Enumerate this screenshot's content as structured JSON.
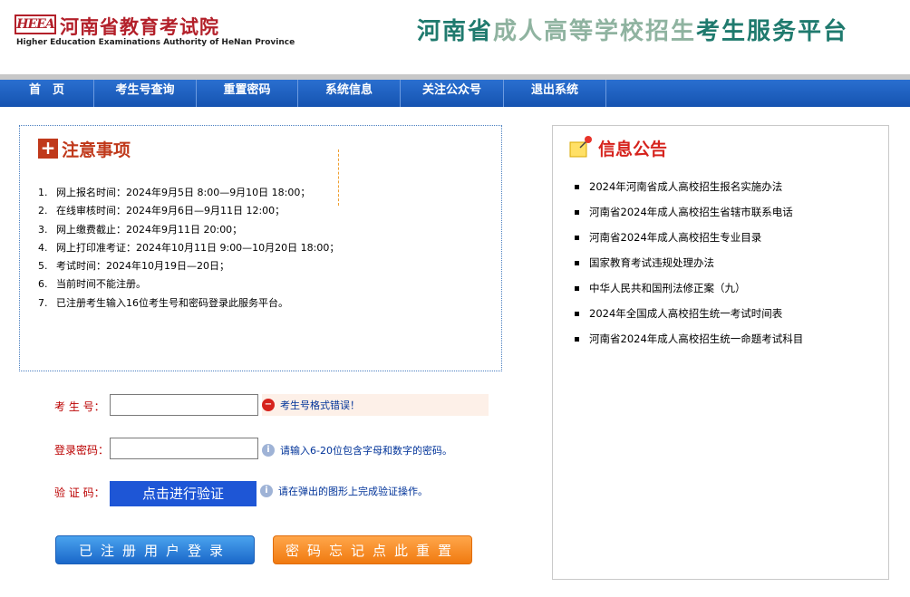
{
  "header": {
    "logo_badge": "HEEA",
    "logo_cn": "河南省教育考试院",
    "logo_en": "Higher Education Examinations Authority of HeNan Province",
    "title_part1": "河南省",
    "title_part2": "成人高等学校招生",
    "title_part3": "考生服务平台"
  },
  "nav": {
    "items": [
      {
        "label": "首　页"
      },
      {
        "label": "考生号查询"
      },
      {
        "label": "重置密码"
      },
      {
        "label": "系统信息"
      },
      {
        "label": "关注公众号"
      },
      {
        "label": "退出系统"
      }
    ]
  },
  "notice": {
    "title": "注意事项",
    "icon": "plus-icon",
    "items": [
      {
        "num": "1.",
        "text": "网上报名时间：2024年9月5日 8:00—9月10日 18:00；"
      },
      {
        "num": "2.",
        "text": "在线审核时间：2024年9月6日—9月11日 12:00；"
      },
      {
        "num": "3.",
        "text": "网上缴费截止：2024年9月11日 20:00；"
      },
      {
        "num": "4.",
        "text": "网上打印准考证：2024年10月11日 9:00—10月20日 18:00；"
      },
      {
        "num": "5.",
        "text": "考试时间：2024年10月19日—20日；"
      },
      {
        "num": "6.",
        "text": "当前时间不能注册。"
      },
      {
        "num": "7.",
        "text": "已注册考生输入16位考生号和密码登录此服务平台。"
      }
    ]
  },
  "form": {
    "examinee_label": "考 生 号：",
    "examinee_value": "",
    "examinee_error": "考生号格式错误！",
    "password_label": "登录密码：",
    "password_value": "",
    "password_hint": "请输入6-20位包含字母和数字的密码。",
    "captcha_label": "验 证 码：",
    "captcha_button": "点击进行验证",
    "captcha_hint": "请在弹出的图形上完成验证操作。",
    "login_button": "已注册用户登录",
    "reset_button": "密码忘记点此重置"
  },
  "bulletin": {
    "title": "信息公告",
    "icon": "pushpin-note-icon",
    "items": [
      {
        "label": "2024年河南省成人高校招生报名实施办法"
      },
      {
        "label": "河南省2024年成人高校招生省辖市联系电话"
      },
      {
        "label": "河南省2024年成人高校招生专业目录"
      },
      {
        "label": "国家教育考试违规处理办法"
      },
      {
        "label": "中华人民共和国刑法修正案（九）"
      },
      {
        "label": "2024年全国成人高校招生统一考试时间表"
      },
      {
        "label": "河南省2024年成人高校招生统一命题考试科目"
      }
    ]
  },
  "colors": {
    "brand_red": "#b3202a",
    "title_green": "#1f7a6e",
    "title_light_green": "#8fb3a0",
    "nav_blue": "#1553b0",
    "error_red": "#d6231d",
    "hint_blue": "#003399"
  }
}
